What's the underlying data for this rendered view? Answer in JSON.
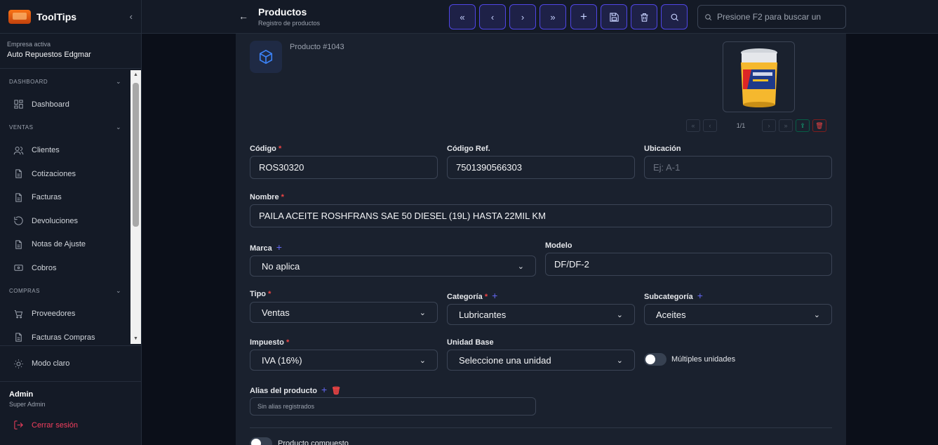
{
  "brand": {
    "name": "ToolTips"
  },
  "company": {
    "label": "Empresa activa",
    "name": "Auto Repuestos Edgmar"
  },
  "sidebar": {
    "sections": [
      {
        "title": "DASHBOARD",
        "items": [
          {
            "label": "Dashboard",
            "icon": "grid-icon"
          }
        ]
      },
      {
        "title": "VENTAS",
        "items": [
          {
            "label": "Clientes",
            "icon": "users-icon"
          },
          {
            "label": "Cotizaciones",
            "icon": "document-icon"
          },
          {
            "label": "Facturas",
            "icon": "document-icon"
          },
          {
            "label": "Devoluciones",
            "icon": "rotate-icon"
          },
          {
            "label": "Notas de Ajuste",
            "icon": "document-icon"
          },
          {
            "label": "Cobros",
            "icon": "banknote-icon"
          }
        ]
      },
      {
        "title": "COMPRAS",
        "items": [
          {
            "label": "Proveedores",
            "icon": "cart-icon"
          },
          {
            "label": "Facturas Compras",
            "icon": "document-icon"
          }
        ]
      }
    ],
    "theme_toggle": "Modo claro",
    "user": {
      "name": "Admin",
      "role": "Super Admin"
    },
    "logout": "Cerrar sesión"
  },
  "header": {
    "title": "Productos",
    "subtitle": "Registro de productos",
    "search_placeholder": "Presione F2 para buscar un"
  },
  "product": {
    "number": "Producto #1043",
    "image_counter": "1/1",
    "fields": {
      "codigo": {
        "label": "Código",
        "value": "ROS30320"
      },
      "codigo_ref": {
        "label": "Código Ref.",
        "value": "7501390566303"
      },
      "ubicacion": {
        "label": "Ubicación",
        "placeholder": "Ej: A-1"
      },
      "nombre": {
        "label": "Nombre",
        "value": "PAILA ACEITE ROSHFRANS SAE 50 DIESEL (19L) HASTA 22MIL KM"
      },
      "marca": {
        "label": "Marca",
        "value": "No aplica"
      },
      "modelo": {
        "label": "Modelo",
        "value": "DF/DF-2"
      },
      "tipo": {
        "label": "Tipo",
        "value": "Ventas"
      },
      "categoria": {
        "label": "Categoría",
        "value": "Lubricantes"
      },
      "subcategoria": {
        "label": "Subcategoría",
        "value": "Aceites"
      },
      "impuesto": {
        "label": "Impuesto",
        "value": "IVA (16%)"
      },
      "unidad_base": {
        "label": "Unidad Base",
        "value": "Seleccione una unidad"
      },
      "multiples_unidades": {
        "label": "Múltiples unidades",
        "on": false
      },
      "alias": {
        "label": "Alias del producto",
        "empty": "Sin alias registrados"
      },
      "compuesto": {
        "label": "Producto compuesto",
        "on": false
      }
    }
  },
  "colors": {
    "accent": "#4f46e5",
    "danger": "#ef4444",
    "success": "#10b981",
    "background": "#0b0f19",
    "panel": "#1a212e"
  }
}
